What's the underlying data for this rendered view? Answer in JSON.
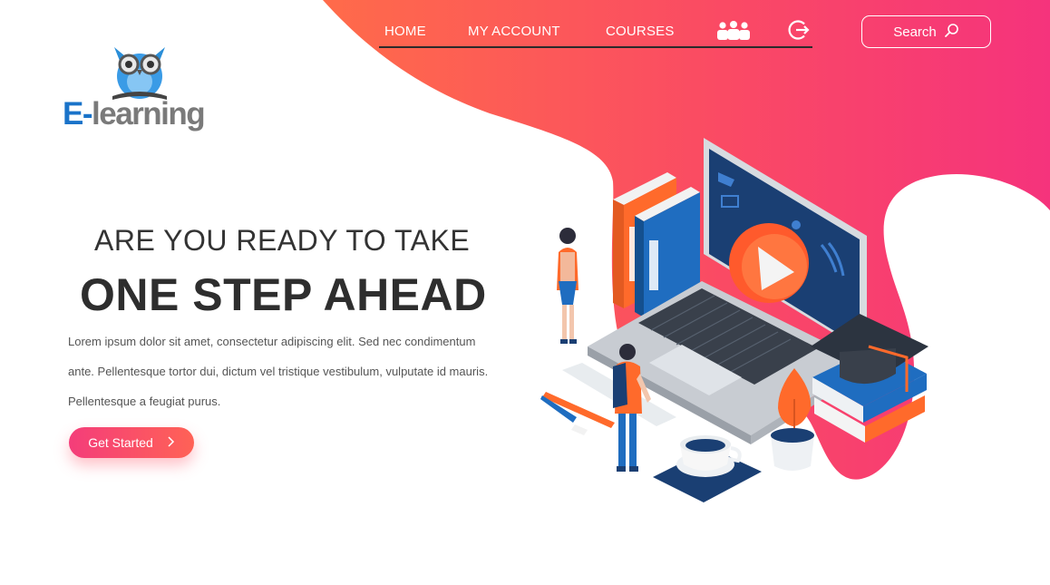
{
  "nav": {
    "items": [
      {
        "label": "HOME",
        "active": true
      },
      {
        "label": "MY ACCOUNT",
        "active": false
      },
      {
        "label": "COURSES",
        "active": false
      }
    ],
    "icons": [
      "users-icon",
      "logout-icon"
    ]
  },
  "search": {
    "label": "Search",
    "icon": "search-icon"
  },
  "logo": {
    "text_prefix": "E-",
    "text_rest": "learning",
    "icon": "owl-icon"
  },
  "hero": {
    "subtitle": "ARE YOU READY TO TAKE",
    "title": "ONE STEP AHEAD",
    "description": "Lorem ipsum dolor sit amet, consectetur adipiscing elit. Sed nec condimentum ante. Pellentesque tortor dui, dictum vel tristique vestibulum, vulputate id mauris. Pellentesque a feugiat purus.",
    "cta_label": "Get Started",
    "cta_icon": "chevron-right-icon"
  },
  "colors": {
    "gradient_start": "#ff6b4a",
    "gradient_end": "#f5337c",
    "accent_orange": "#ff5a2c",
    "accent_blue": "#1d5fa8",
    "dark_text": "#2e2e2e"
  },
  "illustration": {
    "name": "isometric-elearning-illustration"
  }
}
